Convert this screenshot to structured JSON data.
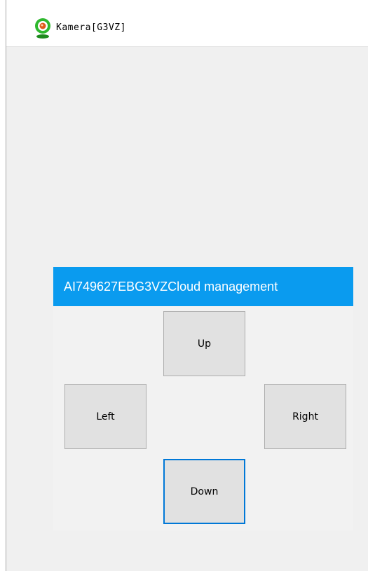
{
  "window": {
    "title": "Kamera[G3VZ]",
    "icon": "webcam-icon",
    "icon_color": "#2eb82e"
  },
  "banner": {
    "text": "AI749627EBG3VZCloud management",
    "background": "#0a9bef"
  },
  "controls": {
    "up_label": "Up",
    "left_label": "Left",
    "right_label": "Right",
    "down_label": "Down",
    "focused": "Down",
    "focus_color": "#0078d7"
  }
}
